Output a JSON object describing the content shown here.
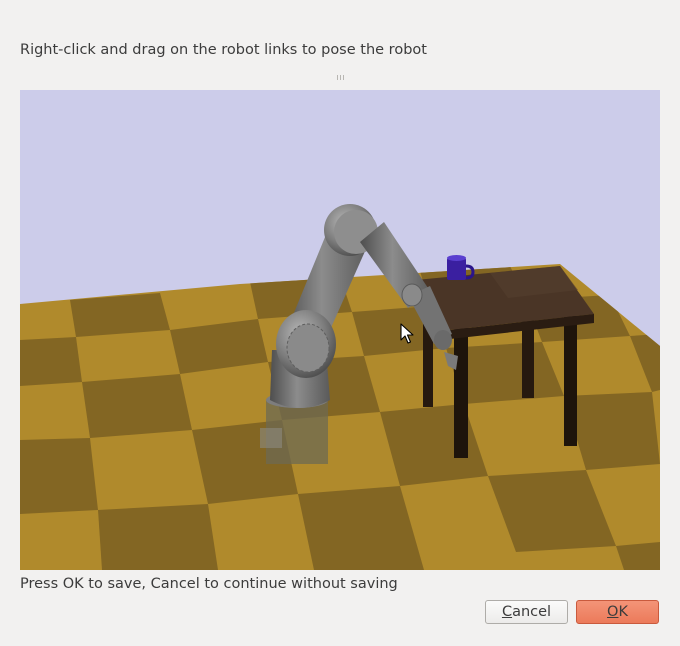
{
  "dialog": {
    "instruction": "Right-click and drag on the robot links to pose the robot",
    "footer_text": "Press OK to save, Cancel to continue without saving"
  },
  "buttons": {
    "cancel": {
      "mnemonic": "C",
      "rest": "ancel"
    },
    "ok": {
      "mnemonic": "O",
      "rest": "K"
    }
  },
  "scene": {
    "sky_color": "#ccccea",
    "floor_light": "#b08a2c",
    "floor_dark": "#836623",
    "table_color": "#3a2a1e",
    "robot_color": "#7e7e7e",
    "mug_color": "#3a1fa0"
  },
  "icons": {
    "cursor": "mouse-pointer-icon",
    "splitter": "splitter-grip-icon"
  }
}
